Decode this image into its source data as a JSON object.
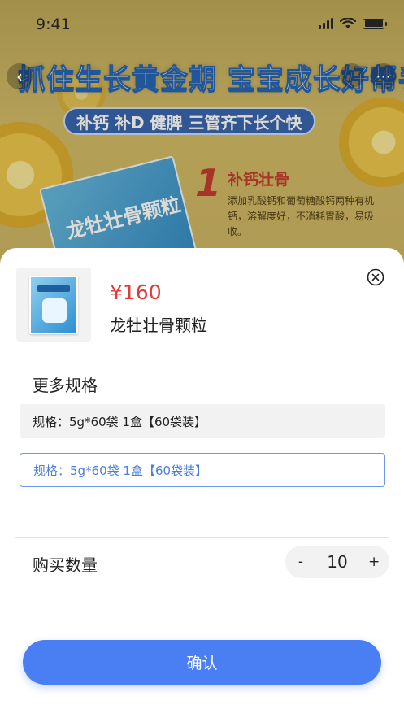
{
  "status_bar": {
    "time": "9:41"
  },
  "banner": {
    "headline": "抓住生长黄金期 宝宝成长好帮手",
    "subtitle": "补钙 补D 健脾 三管齐下长个快",
    "feature_number": "1",
    "feature_title": "补钙壮骨",
    "feature_desc": "添加乳酸钙和葡萄糖酸钙两种有机钙，溶解度好，不消耗胃酸，易吸收。",
    "package_text": "龙牡壮骨颗粒"
  },
  "product": {
    "price": "¥160",
    "name": "龙牡壮骨颗粒"
  },
  "specs": {
    "title": "更多规格",
    "options": [
      {
        "label": "规格：5g*60袋 1盒【60袋装】",
        "selected": false
      },
      {
        "label": "规格：5g*60袋 1盒【60袋装】",
        "selected": true
      }
    ]
  },
  "quantity": {
    "label": "购买数量",
    "minus": "-",
    "value": "10",
    "plus": "+"
  },
  "confirm_label": "确认",
  "colors": {
    "price": "#e03a3a",
    "accent": "#4a7ff4",
    "selected_spec": "#4a7fd9"
  }
}
